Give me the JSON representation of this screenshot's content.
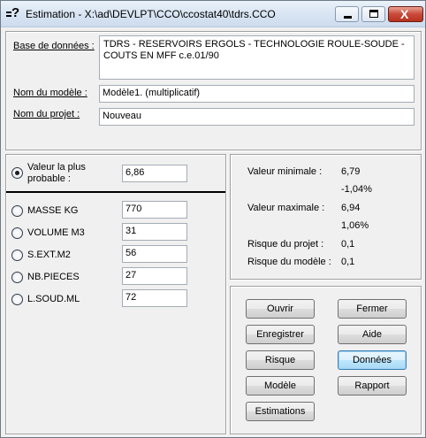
{
  "window": {
    "title": "Estimation - X:\\ad\\DEVLPT\\CCO\\ccostat40\\tdrs.CCO",
    "min_glyph": "",
    "close_glyph": "X"
  },
  "header": {
    "database_label": "Base de données :",
    "database_value": "TDRS - RESERVOIRS ERGOLS - TECHNOLOGIE ROULE-SOUDE - COUTS EN MFF c.e.01/90",
    "model_label": "Nom du modèle :",
    "model_value": "Modèle1. (multiplicatif)",
    "project_label": "Nom du projet :",
    "project_value": "Nouveau"
  },
  "variables": {
    "most_probable_label": "Valeur la plus probable :",
    "most_probable_value": "6,86",
    "items": [
      {
        "label": "MASSE KG",
        "value": "770"
      },
      {
        "label": "VOLUME M3",
        "value": "31"
      },
      {
        "label": "S.EXT.M2",
        "value": "56"
      },
      {
        "label": "NB.PIECES",
        "value": "27"
      },
      {
        "label": "L.SOUD.ML",
        "value": "72"
      }
    ]
  },
  "results": {
    "min_label": "Valeur minimale :",
    "min_value": "6,79",
    "min_pct": "-1,04%",
    "max_label": "Valeur maximale :",
    "max_value": "6,94",
    "max_pct": "1,06%",
    "project_risk_label": "Risque du projet :",
    "project_risk_value": "0,1",
    "model_risk_label": "Risque du modèle :",
    "model_risk_value": "0,1"
  },
  "buttons": {
    "ouvrir": "Ouvrir",
    "fermer": "Fermer",
    "enregistrer": "Enregistrer",
    "aide": "Aide",
    "risque": "Risque",
    "donnees": "Données",
    "modele": "Modèle",
    "rapport": "Rapport",
    "estimations": "Estimations"
  }
}
